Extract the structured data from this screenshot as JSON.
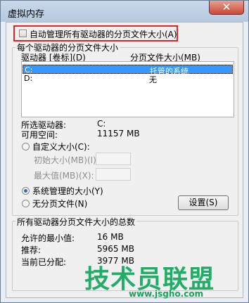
{
  "window": {
    "title": "虚拟内存",
    "close_glyph": "✕"
  },
  "auto_manage": {
    "label": "自动管理所有驱动器的分页文件大小(A)",
    "checked": false
  },
  "drive_group": {
    "label": "每个驱动器的分页文件大小",
    "columns": [
      "驱动器 [卷标](D)",
      "分页文件大小(MB)"
    ],
    "rows": [
      {
        "drive": "C:",
        "size": "托管的系统",
        "selected": true
      },
      {
        "drive": "D:",
        "size": "无",
        "selected": false
      }
    ],
    "selected_drive_label": "所选驱动器:",
    "selected_drive_value": "C:",
    "free_space_label": "可用空间:",
    "free_space_value": "11157 MB",
    "custom_size": {
      "label": "自定义大小(C):",
      "selected": false
    },
    "initial_size": {
      "label": "初始大小(MB)(I):",
      "value": ""
    },
    "max_size": {
      "label": "最大值(MB)(X):",
      "value": ""
    },
    "system_managed": {
      "label": "系统管理的大小(Y)",
      "selected": true
    },
    "no_paging": {
      "label": "无分页文件(N)",
      "selected": false
    },
    "set_button": "设置(S)"
  },
  "total_group": {
    "label": "所有驱动器分页文件大小的总数",
    "min_allowed_label": "允许的最小值:",
    "min_allowed_value": "16 MB",
    "recommended_label": "推荐:",
    "recommended_value": "5965 MB",
    "current_label": "当前已分配:",
    "current_value": "3977 MB"
  },
  "watermark": {
    "text": "技术员联盟",
    "url": "www.jsgho.com"
  }
}
